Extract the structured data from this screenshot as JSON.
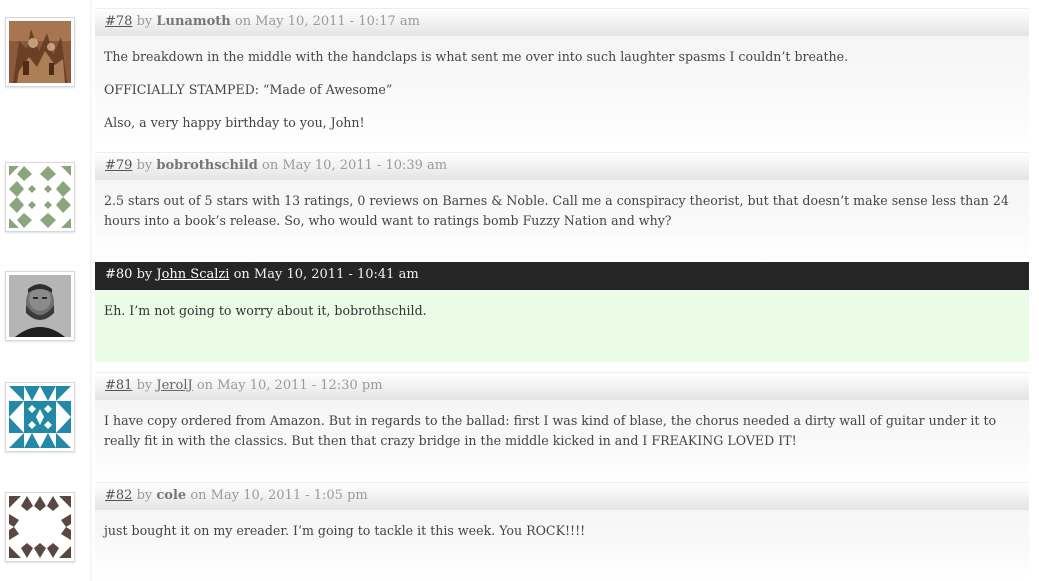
{
  "comments": [
    {
      "number": "#78",
      "by": "by",
      "author": "Lunamoth",
      "on": "on",
      "date": "May 10, 2011 - 10:17 am",
      "paragraphs": [
        "The breakdown in the middle with the handclaps is what sent me over into such laughter spasms I couldn’t breathe.",
        "OFFICIALLY STAMPED: “Made of Awesome”",
        "Also, a very happy birthday to you, John!"
      ],
      "avatar": "photo-avatar"
    },
    {
      "number": "#79",
      "by": "by",
      "author": "bobrothschild",
      "on": "on",
      "date": "May 10, 2011 - 10:39 am",
      "paragraphs": [
        "2.5 stars out of 5 stars with 13 ratings, 0 reviews on Barnes & Noble. Call me a conspiracy theorist, but that doesn’t make sense less than 24 hours into a book’s release. So, who would want to ratings bomb Fuzzy Nation and why?"
      ],
      "avatar": "identicon-green"
    },
    {
      "number": "#80",
      "by": "by",
      "author": "John Scalzi",
      "on": "on",
      "date": "May 10, 2011 - 10:41 am",
      "paragraphs": [
        "Eh. I’m not going to worry about it, bobrothschild."
      ],
      "avatar": "photo-avatar-author",
      "featured": true
    },
    {
      "number": "#81",
      "by": "by",
      "author": "JerolJ",
      "on": "on",
      "date": "May 10, 2011 - 12:30 pm",
      "paragraphs": [
        "I have copy ordered from Amazon. But in regards to the ballad: first I was kind of blase, the chorus needed a dirty wall of guitar under it to really fit in with the classics. But then that crazy bridge in the middle kicked in and I FREAKING LOVED IT!"
      ],
      "avatar": "identicon-blue"
    },
    {
      "number": "#82",
      "by": "by",
      "author": "cole",
      "on": "on",
      "date": "May 10, 2011 - 1:05 pm",
      "paragraphs": [
        "just bought it on my ereader. I’m going to tackle it this week. You ROCK!!!!"
      ],
      "avatar": "identicon-brown"
    }
  ],
  "colors": {
    "featured_header": "#262626",
    "featured_body": "#eafbe6",
    "identicon_green": "#8aa67d",
    "identicon_blue": "#2389a6",
    "identicon_brown": "#5a4643"
  }
}
